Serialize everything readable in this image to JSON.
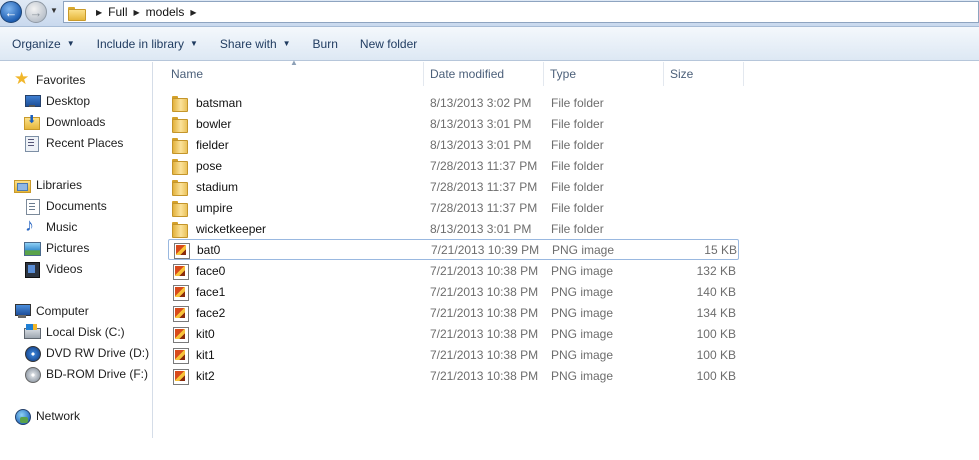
{
  "address": {
    "crumbs": [
      "Full",
      "models"
    ]
  },
  "toolbar": {
    "organize": "Organize",
    "include_library": "Include in library",
    "share_with": "Share with",
    "burn": "Burn",
    "new_folder": "New folder"
  },
  "nav": {
    "favorites": "Favorites",
    "desktop": "Desktop",
    "downloads": "Downloads",
    "recent": "Recent Places",
    "libraries": "Libraries",
    "documents": "Documents",
    "music": "Music",
    "pictures": "Pictures",
    "videos": "Videos",
    "computer": "Computer",
    "local_disk": "Local Disk (C:)",
    "dvd": "DVD RW Drive (D:) R",
    "bd": "BD-ROM Drive (F:) C",
    "network": "Network"
  },
  "columns": {
    "name": "Name",
    "date": "Date modified",
    "type": "Type",
    "size": "Size"
  },
  "files": [
    {
      "name": "batsman",
      "date": "8/13/2013 3:02 PM",
      "type": "File folder",
      "size": ""
    },
    {
      "name": "bowler",
      "date": "8/13/2013 3:01 PM",
      "type": "File folder",
      "size": ""
    },
    {
      "name": "fielder",
      "date": "8/13/2013 3:01 PM",
      "type": "File folder",
      "size": ""
    },
    {
      "name": "pose",
      "date": "7/28/2013 11:37 PM",
      "type": "File folder",
      "size": ""
    },
    {
      "name": "stadium",
      "date": "7/28/2013 11:37 PM",
      "type": "File folder",
      "size": ""
    },
    {
      "name": "umpire",
      "date": "7/28/2013 11:37 PM",
      "type": "File folder",
      "size": ""
    },
    {
      "name": "wicketkeeper",
      "date": "8/13/2013 3:01 PM",
      "type": "File folder",
      "size": ""
    },
    {
      "name": "bat0",
      "date": "7/21/2013 10:39 PM",
      "type": "PNG image",
      "size": "15 KB"
    },
    {
      "name": "face0",
      "date": "7/21/2013 10:38 PM",
      "type": "PNG image",
      "size": "132 KB"
    },
    {
      "name": "face1",
      "date": "7/21/2013 10:38 PM",
      "type": "PNG image",
      "size": "140 KB"
    },
    {
      "name": "face2",
      "date": "7/21/2013 10:38 PM",
      "type": "PNG image",
      "size": "134 KB"
    },
    {
      "name": "kit0",
      "date": "7/21/2013 10:38 PM",
      "type": "PNG image",
      "size": "100 KB"
    },
    {
      "name": "kit1",
      "date": "7/21/2013 10:38 PM",
      "type": "PNG image",
      "size": "100 KB"
    },
    {
      "name": "kit2",
      "date": "7/21/2013 10:38 PM",
      "type": "PNG image",
      "size": "100 KB"
    }
  ]
}
